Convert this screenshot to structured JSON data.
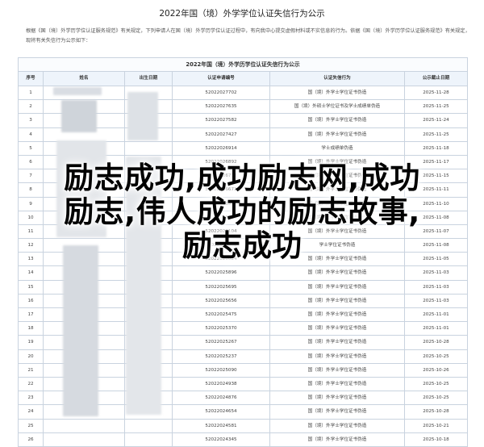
{
  "page_title": "2022年国（境）外学学位认证失信行为公示",
  "intro": {
    "line1": "根据《国（境）外学历学位认证服务规范》有关规定，下列申请人在国（境）外学历学位认证过程中，有向我中心提交虚假材料或不实信息的行为。依据《国（境）外学历学位认证服务规范》有关规定，",
    "line2": "现将有关失信行为公示如下："
  },
  "table": {
    "caption": "2022年国（境）外学历学位认证失信行为公示",
    "headers": [
      "序号",
      "姓名",
      "出生日期",
      "认证申请编号",
      "认证失信行为",
      "公示截止日期"
    ],
    "rows": [
      [
        "1",
        "",
        "",
        "52022027702",
        "国（境）外学士学位证书伪造",
        "2025-11-28"
      ],
      [
        "2",
        "",
        "",
        "52022027635",
        "国（境）外硕士学位证书及学士成绩单伪造",
        "2025-11-25"
      ],
      [
        "3",
        "",
        "",
        "52022027582",
        "国（境）外学士学位证书伪造",
        "2025-11-24"
      ],
      [
        "4",
        "",
        "",
        "52022027427",
        "国（境）外学士学位证书伪造",
        "2025-11-25"
      ],
      [
        "5",
        "",
        "",
        "52022026914",
        "学士成绩单伪造",
        "2025-11-18"
      ],
      [
        "6",
        "",
        "",
        "52022026892",
        "国（境）外学士学位证书伪造",
        "2025-11-17"
      ],
      [
        "7",
        "",
        "",
        "52022026770",
        "国（境）外学士学位证书伪造",
        "2025-11-15"
      ],
      [
        "8",
        "",
        "",
        "52022026671",
        "国（境）外学士学位证书伪造",
        "2025-11-11"
      ],
      [
        "9",
        "",
        "",
        "52022026559",
        "国（境）外学士学位证书伪造",
        "2025-11-10"
      ],
      [
        "10",
        "",
        "",
        "52022026315",
        "国（境）外学士学位证书伪造",
        "2025-11-08"
      ],
      [
        "11",
        "",
        "",
        "52022026104",
        "国（境）外学士学位证书伪造",
        "2025-11-07"
      ],
      [
        "12",
        "",
        "",
        "52022026052",
        "学士学位证书伪造",
        "2025-11-08"
      ],
      [
        "13",
        "",
        "",
        "52022026024",
        "国（境）外学士学位证书伪造",
        "2025-11-05"
      ],
      [
        "14",
        "",
        "",
        "52022025896",
        "国（境）外学士学位证书伪造",
        "2025-11-03"
      ],
      [
        "15",
        "",
        "",
        "52022025695",
        "国（境）外学士学位证书伪造",
        "2025-11-03"
      ],
      [
        "16",
        "",
        "",
        "52022025656",
        "国（境）外学士学位证书伪造",
        "2025-11-03"
      ],
      [
        "17",
        "",
        "",
        "52022025475",
        "国（境）外学士学位证书伪造",
        "2025-11-01"
      ],
      [
        "18",
        "",
        "",
        "52022025370",
        "国（境）外学士学位证书伪造",
        "2025-11-01"
      ],
      [
        "19",
        "",
        "",
        "52022025267",
        "国（境）外学士学位证书伪造",
        "2025-10-28"
      ],
      [
        "20",
        "",
        "",
        "52022025237",
        "国（境）外学士学位证书伪造",
        "2025-10-25"
      ],
      [
        "21",
        "",
        "",
        "52022025090",
        "国（境）外学士学位证书伪造",
        "2025-10-26"
      ],
      [
        "22",
        "",
        "",
        "52022024938",
        "国（境）外学士学位证书伪造",
        "2025-10-25"
      ],
      [
        "23",
        "",
        "",
        "52022024876",
        "国（境）外学士学位证书伪造",
        "2025-10-25"
      ],
      [
        "24",
        "",
        "",
        "52022024654",
        "国（境）外学士学位证书伪造",
        "2025-10-28"
      ],
      [
        "25",
        "",
        "",
        "52022024581",
        "国（境）外学士学位证书伪造",
        "2025-10-21"
      ],
      [
        "26",
        "",
        "",
        "52022024345",
        "国（境）外学士学位证书伪造",
        "2025-10-18"
      ]
    ]
  },
  "overlay": {
    "line1": "励志成功,成功励志网,成功",
    "line2": "励志,伟人成功的励志故事,",
    "line3": "励志成功"
  }
}
